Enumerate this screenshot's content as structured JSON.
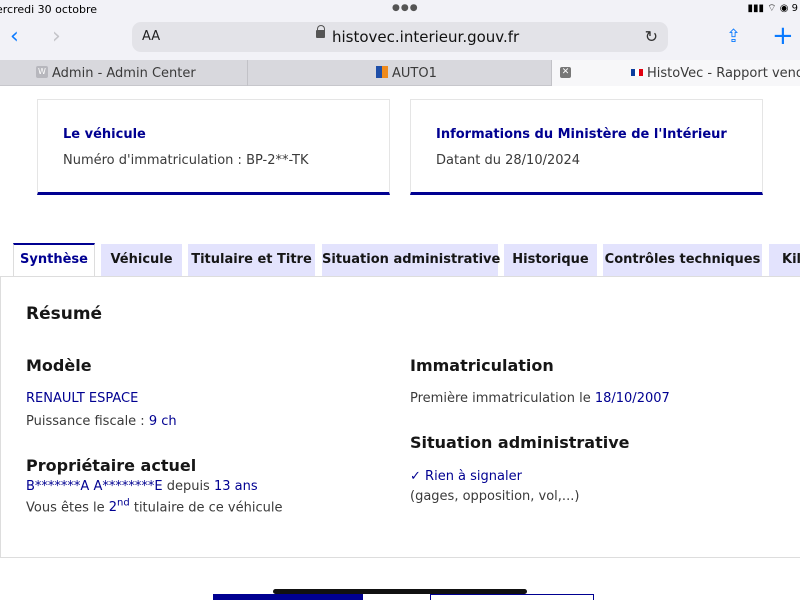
{
  "status": {
    "date": "ercredi 30 octobre",
    "icons": "▮▮▮ ⌔ ◉ 9"
  },
  "browser": {
    "text_size": "AA",
    "url": "histovec.interieur.gouv.fr",
    "tabs": [
      {
        "label": "Admin - Admin Center",
        "favicon": "W"
      },
      {
        "label": "AUTO1"
      },
      {
        "label": "HistoVec - Rapport vendeur"
      }
    ]
  },
  "cards": {
    "vehicle": {
      "title": "Le véhicule",
      "value": "Numéro d'immatriculation : BP-2**-TK"
    },
    "ministry": {
      "title": "Informations du Ministère de l'Intérieur",
      "value": "Datant du 28/10/2024"
    }
  },
  "tabs": [
    "Synthèse",
    "Véhicule",
    "Titulaire et Titre",
    "Situation administrative",
    "Historique",
    "Contrôles techniques",
    "Kilo"
  ],
  "summary": {
    "title": "Résumé",
    "model": {
      "heading": "Modèle",
      "name": "RENAULT ESPACE",
      "power_label": "Puissance fiscale :",
      "power_value": "9 ch"
    },
    "owner": {
      "heading": "Propriétaire actuel",
      "name": "B*******A A********E",
      "since_label": "depuis",
      "since_value": "13 ans",
      "you_are": "Vous êtes le",
      "rank": "2",
      "rank_sup": "nd",
      "suffix": "titulaire de ce véhicule"
    },
    "registration": {
      "heading": "Immatriculation",
      "label": "Première immatriculation le",
      "date": "18/10/2007"
    },
    "admin": {
      "heading": "Situation administrative",
      "status": "Rien à signaler",
      "detail": "(gages, opposition, vol,...)"
    }
  },
  "colors": {
    "primary": "#000091",
    "tab_bg": "#e3e3fd",
    "ios_blue": "#0a7aff"
  }
}
